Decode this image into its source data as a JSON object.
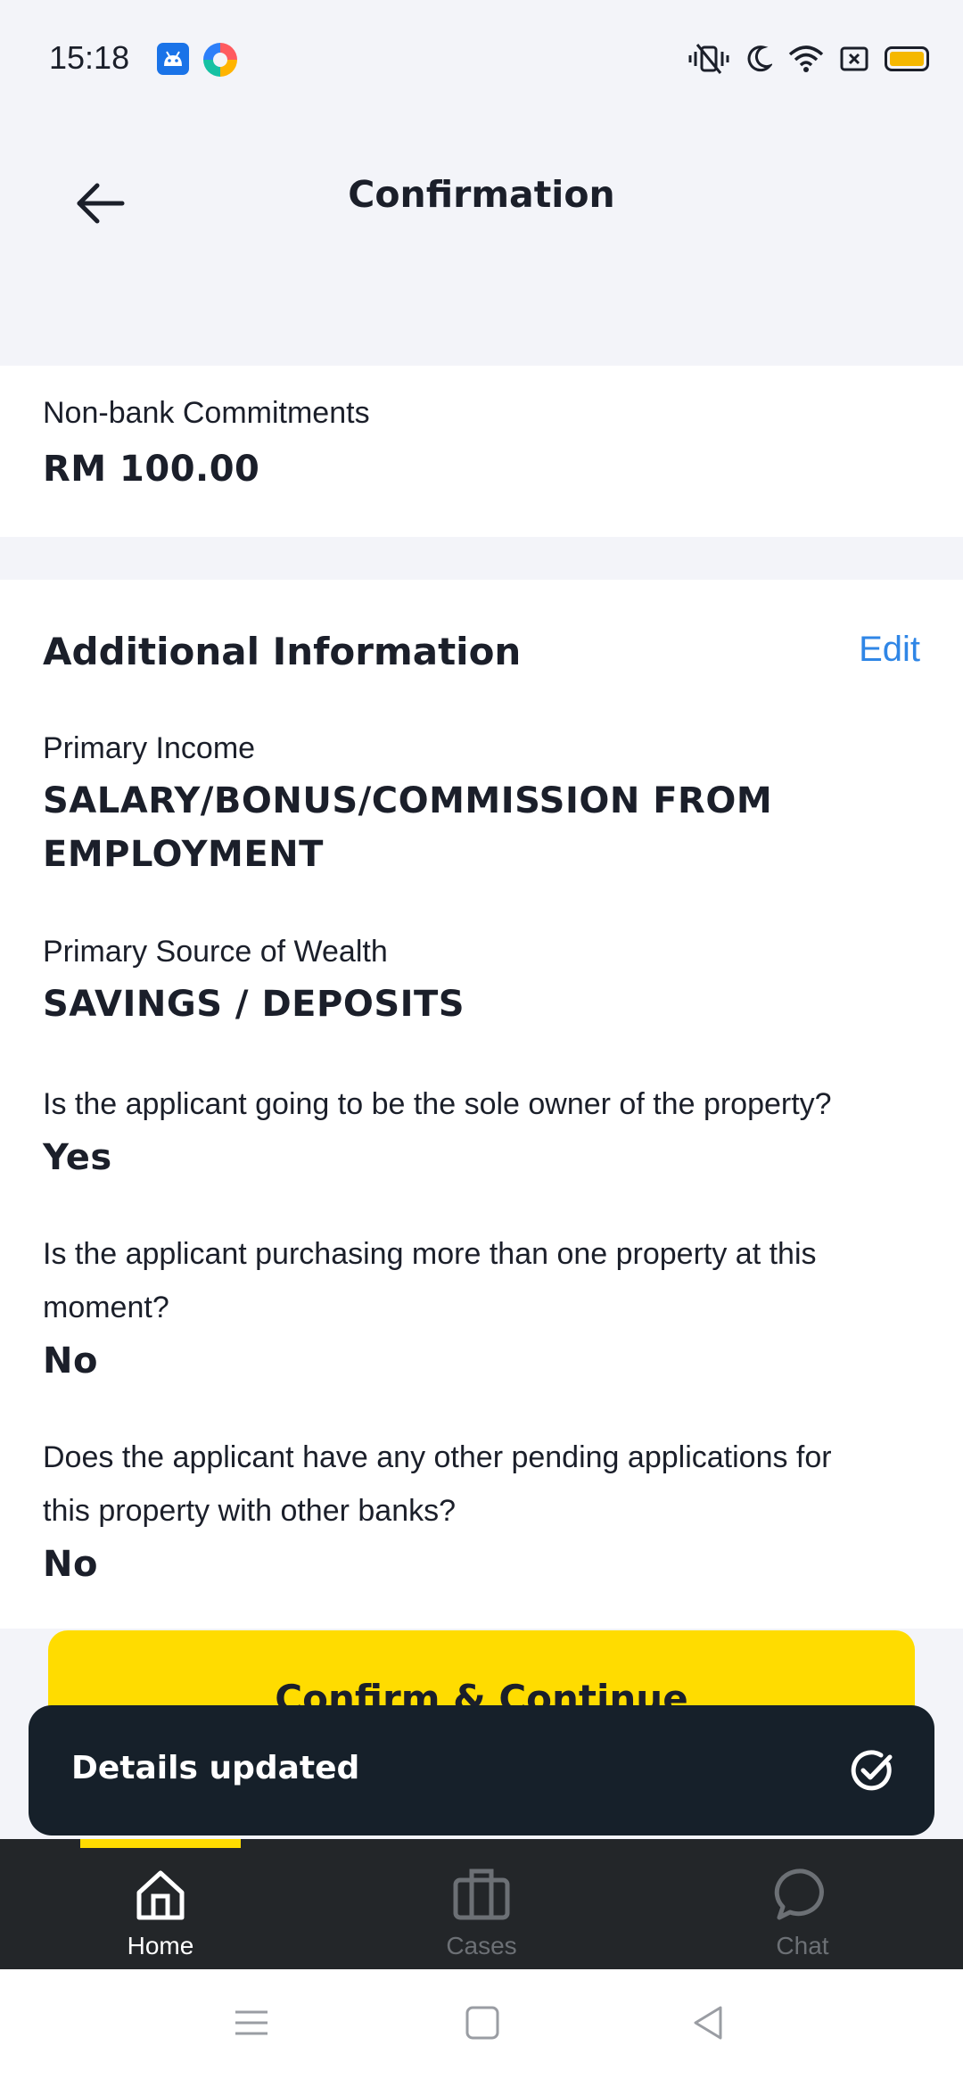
{
  "status_bar": {
    "time": "15:18",
    "icons": [
      "android-app-icon",
      "colorful-app-icon",
      "vibrate-icon",
      "moon-icon",
      "wifi-icon",
      "sim-icon",
      "battery-icon"
    ]
  },
  "header": {
    "title": "Confirmation",
    "back_icon": "arrow-left-icon"
  },
  "non_bank": {
    "label": "Non-bank Commitments",
    "value": "RM 100.00"
  },
  "additional_info": {
    "title": "Additional Information",
    "edit_label": "Edit",
    "fields": [
      {
        "label": "Primary Income",
        "value_line1": "SALARY/BONUS/COMMISSION FROM",
        "value_line2": "EMPLOYMENT"
      },
      {
        "label": "Primary Source of Wealth",
        "value": "SAVINGS / DEPOSITS"
      },
      {
        "question": "Is the applicant going to be the sole owner of the property?",
        "answer": "Yes"
      },
      {
        "question_line1": "Is the applicant purchasing more than one property at this",
        "question_line2": "moment?",
        "answer": "No"
      },
      {
        "question_line1": "Does the applicant have any other pending applications for",
        "question_line2": "this property with other banks?",
        "answer": "No"
      }
    ]
  },
  "confirm_button": {
    "label": "Confirm & Continue"
  },
  "toast": {
    "text": "Details updated",
    "icon": "check-circle-icon"
  },
  "bottom_nav": {
    "items": [
      {
        "label": "Home",
        "icon": "home-icon",
        "active": true
      },
      {
        "label": "Cases",
        "icon": "briefcase-icon",
        "active": false
      },
      {
        "label": "Chat",
        "icon": "chat-bubble-icon",
        "active": false
      }
    ],
    "active_color": "#ffdc00"
  },
  "colors": {
    "accent_yellow": "#ffdc00",
    "link_blue": "#2f86e6",
    "toast_bg": "#16202a",
    "nav_bg": "#232629"
  }
}
